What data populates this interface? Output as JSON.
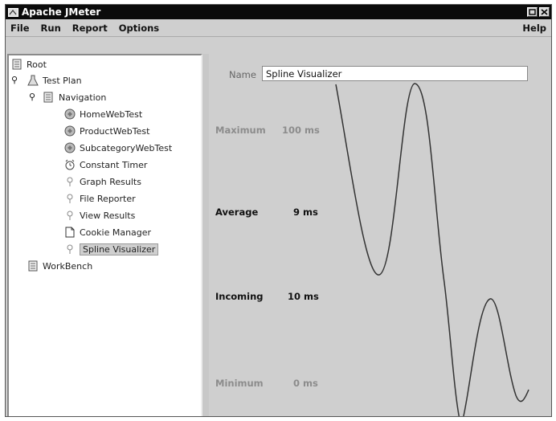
{
  "window": {
    "title": "Apache JMeter"
  },
  "menu": {
    "file": "File",
    "run": "Run",
    "report": "Report",
    "options": "Options",
    "help": "Help"
  },
  "tree": {
    "root": "Root",
    "test_plan": "Test Plan",
    "navigation": "Navigation",
    "home_web_test": "HomeWebTest",
    "product_web_test": "ProductWebTest",
    "subcategory_web_test": "SubcategoryWebTest",
    "constant_timer": "Constant Timer",
    "graph_results": "Graph Results",
    "file_reporter": "File Reporter",
    "view_results": "View Results",
    "cookie_manager": "Cookie Manager",
    "spline_visualizer": "Spline Visualizer",
    "workbench": "WorkBench"
  },
  "panel": {
    "name_label": "Name",
    "name_value": "Spline Visualizer",
    "maximum_label": "Maximum",
    "maximum_value": "100 ms",
    "average_label": "Average",
    "average_value": "9 ms",
    "incoming_label": "Incoming",
    "incoming_value": "10 ms",
    "minimum_label": "Minimum",
    "minimum_value": "0 ms"
  },
  "colors": {
    "titlebar": "#0b0b0b",
    "panel_bg": "#cfcfcf",
    "curve": "#333333"
  }
}
